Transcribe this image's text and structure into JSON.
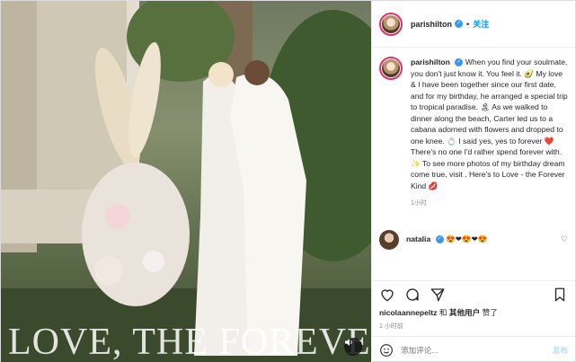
{
  "photo": {
    "overlay_text": "LOVE, THE FOREVER KIND",
    "sound_icon": "speaker-icon"
  },
  "header": {
    "username": "parishilton",
    "verified_glyph": "✓",
    "separator": "•",
    "follow_label": "关注"
  },
  "post": {
    "username": "parishilton",
    "caption": "When you find your soulmate, you don't just know it. You feel it. 🥑 My love & I have been together since our first date, and for my birthday, he arranged a special trip to tropical paradise. 🏝 As we walked to dinner along the beach, Carter led us to a cabana adorned with flowers and dropped to one knee. 💍 I said yes, yes to forever ❤️ There's no one I'd rather spend forever with. ✨ To see more photos of my birthday dream come true, visit                  . Here's to Love - the Forever Kind 💋",
    "timestamp": "1小时"
  },
  "comments": [
    {
      "username": "natalia",
      "text": "😍❤😍❤😍"
    }
  ],
  "actions": {
    "like_icon": "heart-icon",
    "comment_icon": "comment-icon",
    "share_icon": "share-icon",
    "save_icon": "bookmark-icon"
  },
  "likes": {
    "user": "nicolaannepeltz",
    "connector": "和",
    "others": "其他用户",
    "suffix": "赞了"
  },
  "post_time": "1 小时前",
  "comment_box": {
    "emoji_icon": "smiley-icon",
    "placeholder": "添加评论...",
    "post_label": "发布"
  },
  "colors": {
    "accent_blue": "#0095f6",
    "verified_blue": "#3897f0",
    "muted_text": "#8e8e8e",
    "post_disabled": "#b2dffc"
  }
}
